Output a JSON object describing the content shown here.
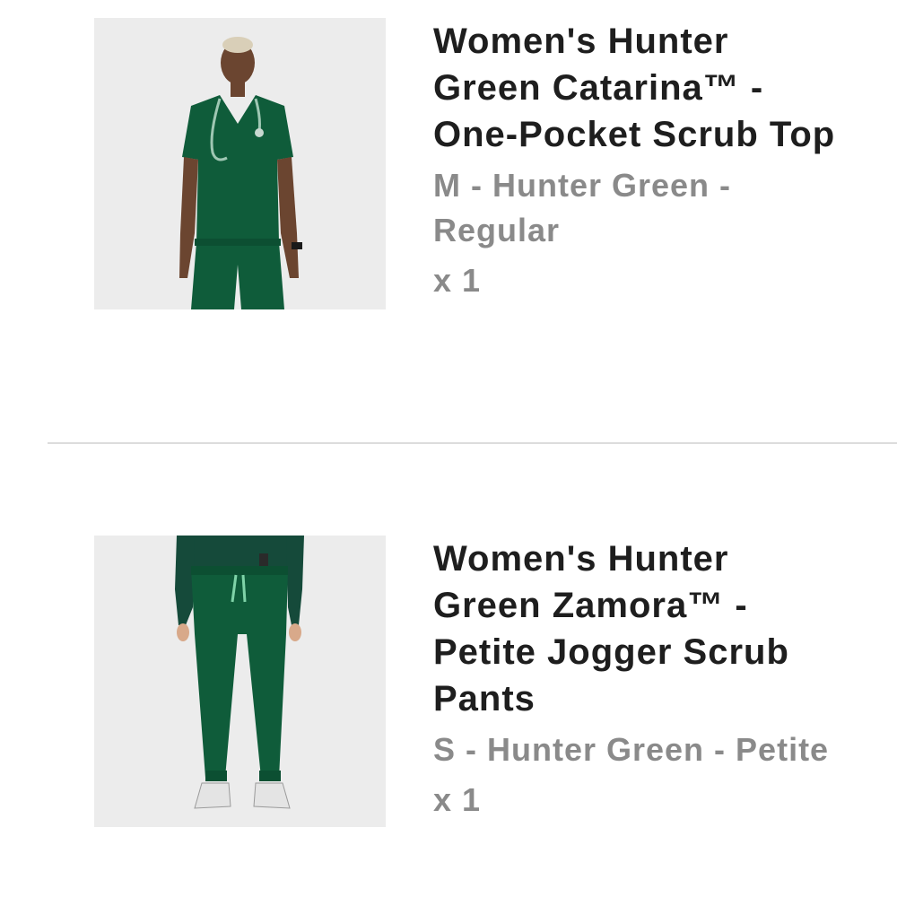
{
  "cart": {
    "items": [
      {
        "image_icon": "product-photo-scrub-top",
        "title": "Women's Hunter Green Catarina™ - One-Pocket Scrub Top",
        "variant": "M - Hunter Green - Regular",
        "quantity": "x 1"
      },
      {
        "image_icon": "product-photo-jogger-pants",
        "title": "Women's Hunter Green Zamora™ - Petite Jogger Scrub Pants",
        "variant": "S - Hunter Green - Petite",
        "quantity": "x 1"
      }
    ]
  },
  "colors": {
    "hunter_green": "#0f5c3a",
    "title_text": "#1e1e1e",
    "meta_text": "#8a8a8a",
    "divider": "#dcdcdc",
    "photo_background": "#ececec"
  }
}
